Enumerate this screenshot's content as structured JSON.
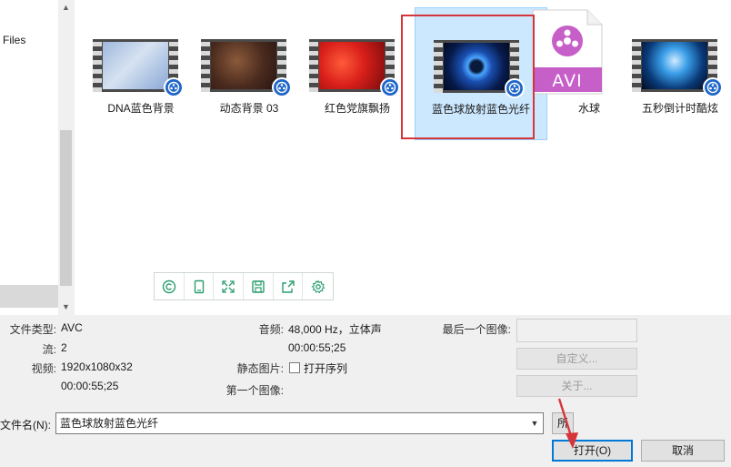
{
  "sidebar": {
    "label": "Files"
  },
  "files": [
    {
      "name": "DNA蓝色背景",
      "thumb": "dna-blue"
    },
    {
      "name": "动态背景 03",
      "thumb": "dynamic-bg"
    },
    {
      "name": "红色党旗飘扬",
      "thumb": "red-flag"
    },
    {
      "name": "蓝色球放射蓝色光纤",
      "thumb": "blue-sphere",
      "selected": true
    },
    {
      "name": "水球",
      "thumb": "avi-doc",
      "type_label": "AVI"
    },
    {
      "name": "五秒倒计时酷炫",
      "thumb": "countdown"
    }
  ],
  "preview_toolbar": [
    "copyright-icon",
    "tablet-icon",
    "fullscreen-icon",
    "save-icon",
    "share-icon",
    "settings-icon"
  ],
  "info": {
    "file_type_label": "文件类型:",
    "file_type_value": "AVC",
    "stream_label": "流:",
    "stream_value": "2",
    "video_label": "视频:",
    "video_value": "1920x1080x32",
    "video_duration": "00:00:55;25",
    "audio_label": "音频:",
    "audio_value": "48,000 Hz，立体声",
    "audio_duration": "00:00:55;25",
    "still_label": "静态图片:",
    "open_sequence_label": "打开序列",
    "first_image_label": "第一个图像:",
    "last_image_label": "最后一个图像:",
    "custom_button": "自定义...",
    "about_button": "关于..."
  },
  "bottom": {
    "filename_label": "文件名(N):",
    "filename_value": "蓝色球放射蓝色光纤",
    "all_button": "所有",
    "open_button": "打开(O)",
    "cancel_button": "取消"
  },
  "colors": {
    "selection": "#cce8ff",
    "highlight_box": "#d6353a",
    "avi_purple": "#c75fc8",
    "badge_blue": "#1e66c7",
    "toolbar_green": "#2a9d6f"
  }
}
